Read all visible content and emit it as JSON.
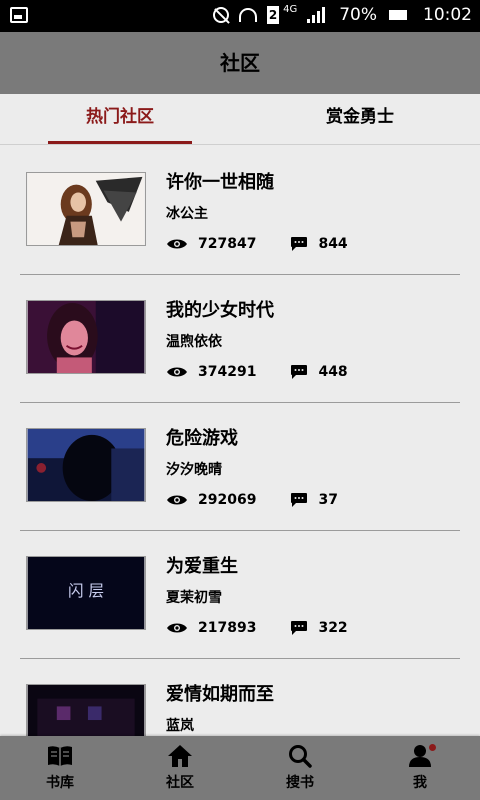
{
  "status_bar": {
    "network": "4G",
    "sim": "2",
    "battery": "70%",
    "time": "10:02"
  },
  "header": {
    "title": "社区"
  },
  "tabs": [
    {
      "label": "热门社区",
      "active": true
    },
    {
      "label": "赏金勇士",
      "active": false
    }
  ],
  "items": [
    {
      "title": "许你一世相随",
      "author": "冰公主",
      "views": "727847",
      "comments": "844"
    },
    {
      "title": "我的少女时代",
      "author": "温煦依依",
      "views": "374291",
      "comments": "448"
    },
    {
      "title": "危险游戏",
      "author": "汐汐晚晴",
      "views": "292069",
      "comments": "37"
    },
    {
      "title": "为爱重生",
      "author": "夏茉初雪",
      "views": "217893",
      "comments": "322"
    },
    {
      "title": "爱情如期而至",
      "author": "蓝岚",
      "views": "",
      "comments": ""
    }
  ],
  "cover_texts": {
    "item3_cover_text": "闪 层"
  },
  "bottom_nav": [
    {
      "label": "书库",
      "icon": "book-icon"
    },
    {
      "label": "社区",
      "icon": "home-icon"
    },
    {
      "label": "搜书",
      "icon": "search-icon"
    },
    {
      "label": "我",
      "icon": "person-icon"
    }
  ],
  "colors": {
    "accent": "#8b1a1a",
    "header_bg": "#7a7a7a",
    "page_bg": "#ececec"
  }
}
